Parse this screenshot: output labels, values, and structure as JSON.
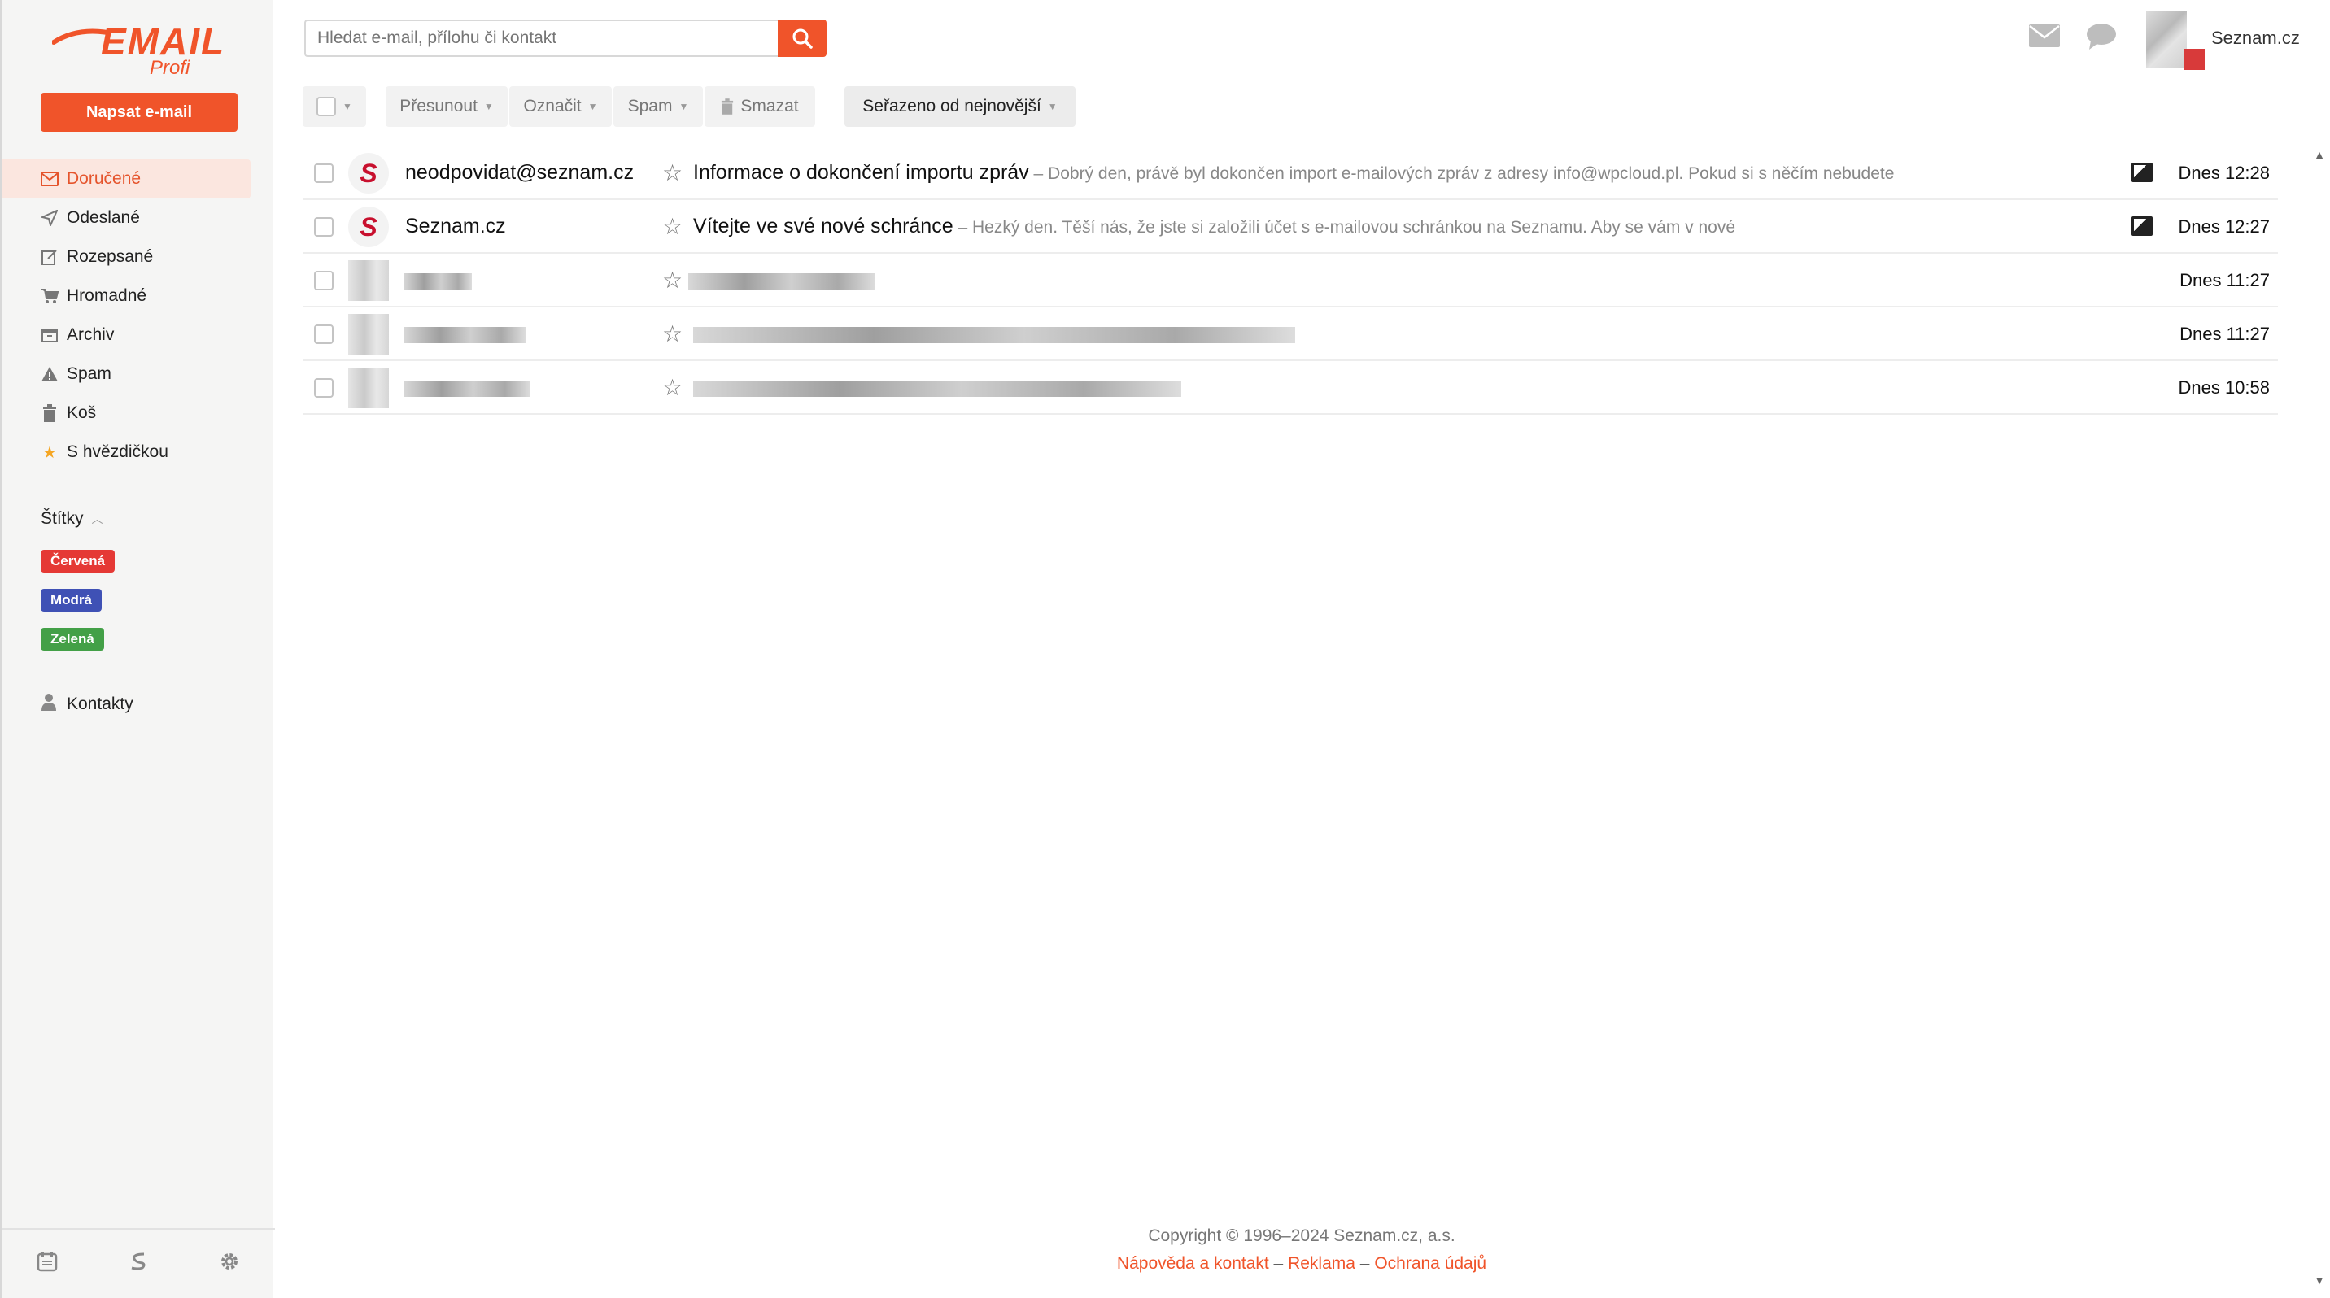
{
  "app": {
    "logo_main": "EMAIL",
    "logo_sub": "Profi",
    "compose_label": "Napsat e-mail",
    "account_name": "Seznam.cz"
  },
  "colors": {
    "brand": "#f0542a",
    "active_bg": "#fbe6df",
    "tag_red": "#e53935",
    "tag_blue": "#3f51b5",
    "tag_green": "#43a047"
  },
  "sidebar": {
    "items": [
      {
        "label": "Doručené",
        "icon": "inbox-icon"
      },
      {
        "label": "Odeslané",
        "icon": "send-icon"
      },
      {
        "label": "Rozepsané",
        "icon": "draft-icon"
      },
      {
        "label": "Hromadné",
        "icon": "cart-icon"
      },
      {
        "label": "Archiv",
        "icon": "archive-icon"
      },
      {
        "label": "Spam",
        "icon": "warning-icon"
      },
      {
        "label": "Koš",
        "icon": "trash-icon"
      },
      {
        "label": "S hvězdičkou",
        "icon": "star-icon"
      }
    ],
    "labels_heading": "Štítky",
    "tags": [
      "Červená",
      "Modrá",
      "Zelená"
    ],
    "contacts_label": "Kontakty"
  },
  "search": {
    "placeholder": "Hledat e-mail, přílohu či kontakt"
  },
  "toolbar": {
    "move": "Přesunout",
    "mark": "Označit",
    "spam": "Spam",
    "delete": "Smazat",
    "sort": "Seřazeno od nejnovější"
  },
  "messages": [
    {
      "sender": "neodpovidat@seznam.cz",
      "subject": "Informace o dokončení importu zpráv",
      "preview": " – Dobrý den, právě byl dokončen import e-mailových zpráv z adresy info@wpcloud.pl. Pokud si s něčím nebudete",
      "time": "Dnes 12:28",
      "attachment": true
    },
    {
      "sender": "Seznam.cz",
      "subject": "Vítejte ve své nové schránce",
      "preview": " – Hezký den. Těší nás, že jste si založili účet s e-mailovou schránkou na Seznamu. Aby se vám v nové",
      "time": "Dnes 12:27",
      "attachment": true
    },
    {
      "time": "Dnes 11:27"
    },
    {
      "time": "Dnes 11:27"
    },
    {
      "time": "Dnes 10:58"
    }
  ],
  "footer": {
    "copyright": "Copyright © 1996–2024 Seznam.cz, a.s.",
    "help": "Nápověda a kontakt",
    "ads": "Reklama",
    "privacy": "Ochrana údajů",
    "dash": " – "
  }
}
